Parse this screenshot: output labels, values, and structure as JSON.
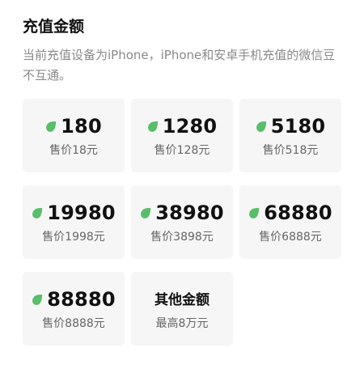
{
  "header": {
    "title": "充值金额",
    "notice": "当前充值设备为iPhone，iPhone和安卓手机充值的微信豆不互通。"
  },
  "icon": {
    "name": "wechat-bean-icon",
    "color": "#58be6a"
  },
  "options": [
    {
      "amount": "180",
      "price": "售价18元"
    },
    {
      "amount": "1280",
      "price": "售价128元"
    },
    {
      "amount": "5180",
      "price": "售价518元"
    },
    {
      "amount": "19980",
      "price": "售价1998元"
    },
    {
      "amount": "38980",
      "price": "售价3898元"
    },
    {
      "amount": "68880",
      "price": "售价6888元"
    },
    {
      "amount": "88880",
      "price": "售价8888元"
    }
  ],
  "other": {
    "title": "其他金额",
    "subtitle": "最高8万元"
  }
}
